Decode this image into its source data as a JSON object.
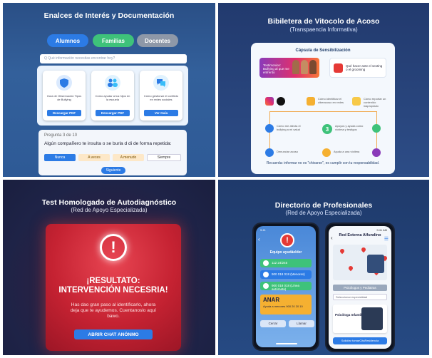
{
  "q1": {
    "title": "Enalces de Interés y Documentación",
    "tabs": [
      {
        "label": "Alumnos",
        "color": "#2c7be5"
      },
      {
        "label": "Familias",
        "color": "#3ec27a"
      },
      {
        "label": "Docentes",
        "color": "#8e98a8"
      }
    ],
    "search_placeholder": "Q Qué información necesitas encontrar hoy?",
    "cards": [
      {
        "icon": "shield-icon",
        "text": "Guía de Observación Tipos de Bullying",
        "button": "Descargar PDF"
      },
      {
        "icon": "people-icon",
        "text": "Cómo ayudar a tus hijos en la escuela",
        "button": "Descargar PDF"
      },
      {
        "icon": "chat-icon",
        "text": "Cómo gestionar el conflicto en redes sociales",
        "button": "Ver Guía"
      }
    ],
    "quiz": {
      "progress": "Pregunta 3 de 10",
      "question": "Algún compañero te insulta o se burla d di de forma repetida:",
      "options": [
        "Nunca",
        "A veces",
        "A menudo",
        "Siempre"
      ],
      "next": "Siguiente"
    }
  },
  "q2": {
    "title": "Bibileterа de Vitocolo de Acoso",
    "subtitle": "(Transpaencia Informativa)",
    "board_title": "Cápsula de Sensibilización",
    "banner_text": "Testimonios: Bullying al que me enfrento",
    "phish_text": "Qué hacer ante el sexting o el grooming",
    "row1": [
      "Cómo identificar el ciberacoso en redes",
      "Cómo reportar un contenido inapropiado"
    ],
    "row2": [
      "Cómo me afecta el bullying a mi salud",
      "Apoyos y ayuda como víctima y testigos"
    ],
    "row3": [
      "Denunciar acoso",
      "Ayuda a una víctima"
    ],
    "footer": "Recuerda: informar no es \"chivarse\", es cumplir con tu responsabilidad."
  },
  "q3": {
    "title": "Test Homologado de Autodiagnóstico",
    "subtitle": "(Red de Apoyo Especializada)",
    "alert_symbol": "!",
    "result_line1": "¡RESULTATO:",
    "result_line2": "INTERVENCIÓN NECESRIA!",
    "message": "Has dao gran paso al identificarlo, ahora deja que te ayudemos. Cuentanoslo aquí bawo.",
    "chat_button": "ABRIR CHAT ANÓNMO"
  },
  "q4": {
    "title": "Directorio de Profesionales",
    "subtitle": "(Red de Apoyo Especializada)",
    "left_phone": {
      "time": "9:41",
      "header": "Equipo ayudáelder",
      "rows": [
        {
          "label": "112 24/245",
          "color": "#3ec27a"
        },
        {
          "label": "900 018 018 (Menores)",
          "color": "#2c7be5"
        },
        {
          "label": "900 018 018 (Línea autómata)",
          "color": "#3ec27a"
        }
      ],
      "anar_title": "ANAR",
      "anar_text": "Ayuda a menores 900 20 20 10",
      "cancel": "Cerrar",
      "confirm": "Llamar"
    },
    "right_phone": {
      "time": "9:41 AM",
      "header": "Red Externa Alfundino",
      "button1": "Psicólogos y Pediatras",
      "select": "Seleccionar especialidad",
      "person_title": "Psicóloga Infantil",
      "button2": "Solicitar tomarCitaResidencia"
    }
  }
}
